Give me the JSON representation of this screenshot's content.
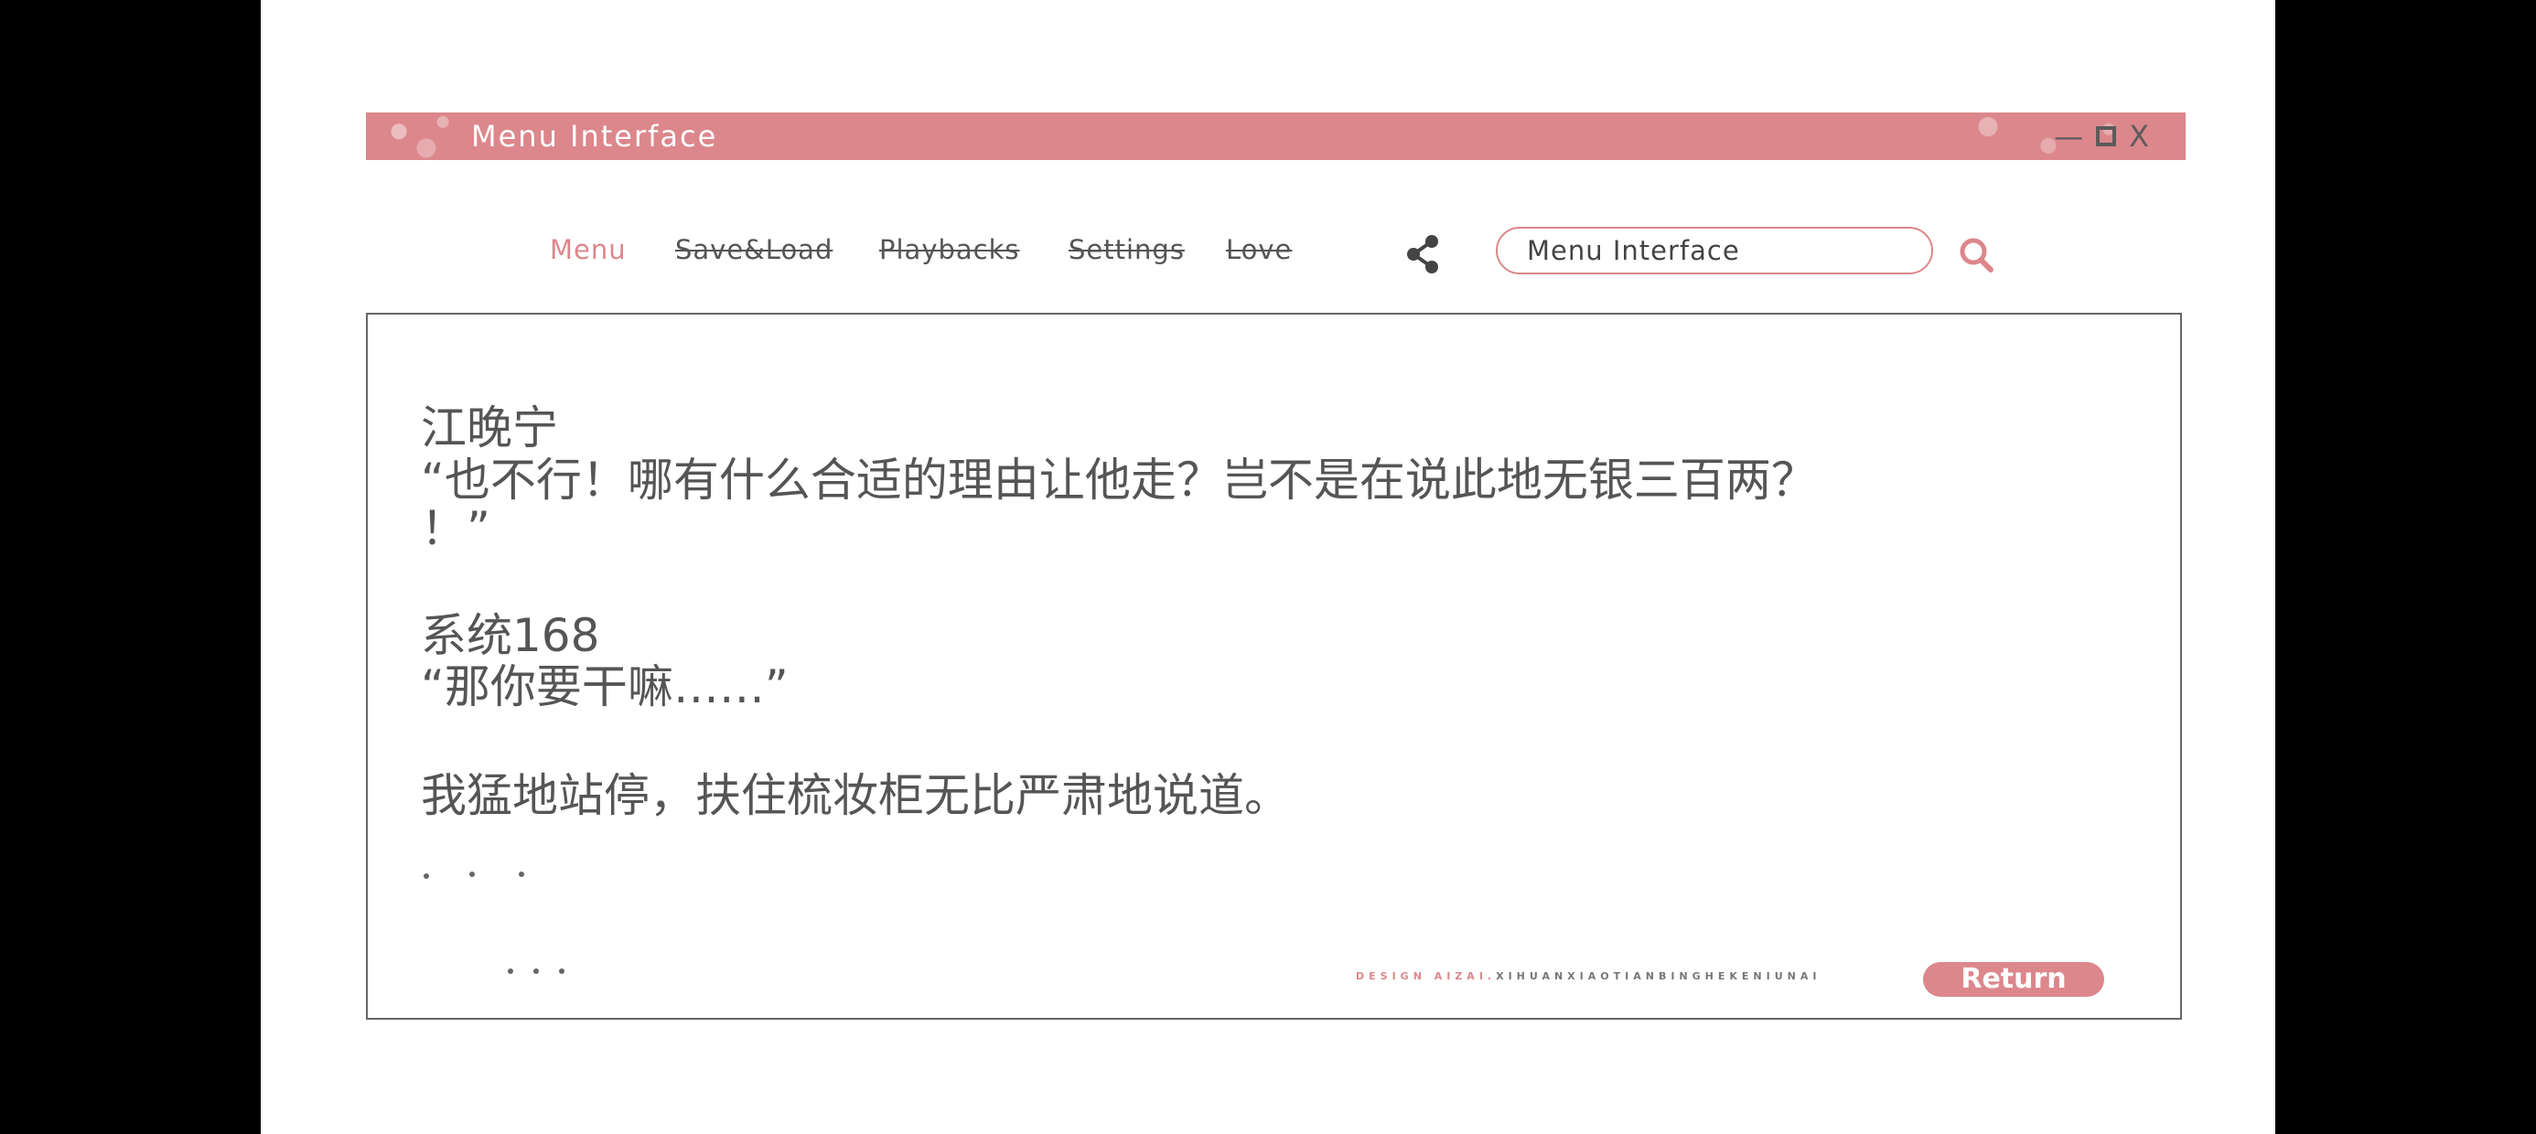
{
  "window": {
    "title": "Menu Interface",
    "controls": [
      "—",
      "X"
    ]
  },
  "nav": {
    "items": [
      {
        "label": "Menu"
      },
      {
        "label": "Save&Load"
      },
      {
        "label": "Playbacks"
      },
      {
        "label": "Settings"
      },
      {
        "label": "Love"
      }
    ],
    "share_icon": "share-icon",
    "search_icon": "search-icon"
  },
  "search": {
    "value": "Menu Interface"
  },
  "dialogue": {
    "entries": [
      {
        "speaker": "江晚宁",
        "line1": "“也不行！哪有什么合适的理由让他走？岂不是在说此地无银三百两？",
        "line2": "！”"
      },
      {
        "speaker": "系统168",
        "line1": "“那你要干嘛……”"
      },
      {
        "narration": "我猛地站停，扶住梳妆柜无比严肃地说道。"
      }
    ]
  },
  "footer": {
    "credit_pink": "DESIGN AIZAI.",
    "credit_rest": "XIHUANXIAOTIANBINGHEKENIUNAI",
    "return_label": "Return"
  },
  "colors": {
    "accent": "#dc878c",
    "text": "#555555"
  }
}
